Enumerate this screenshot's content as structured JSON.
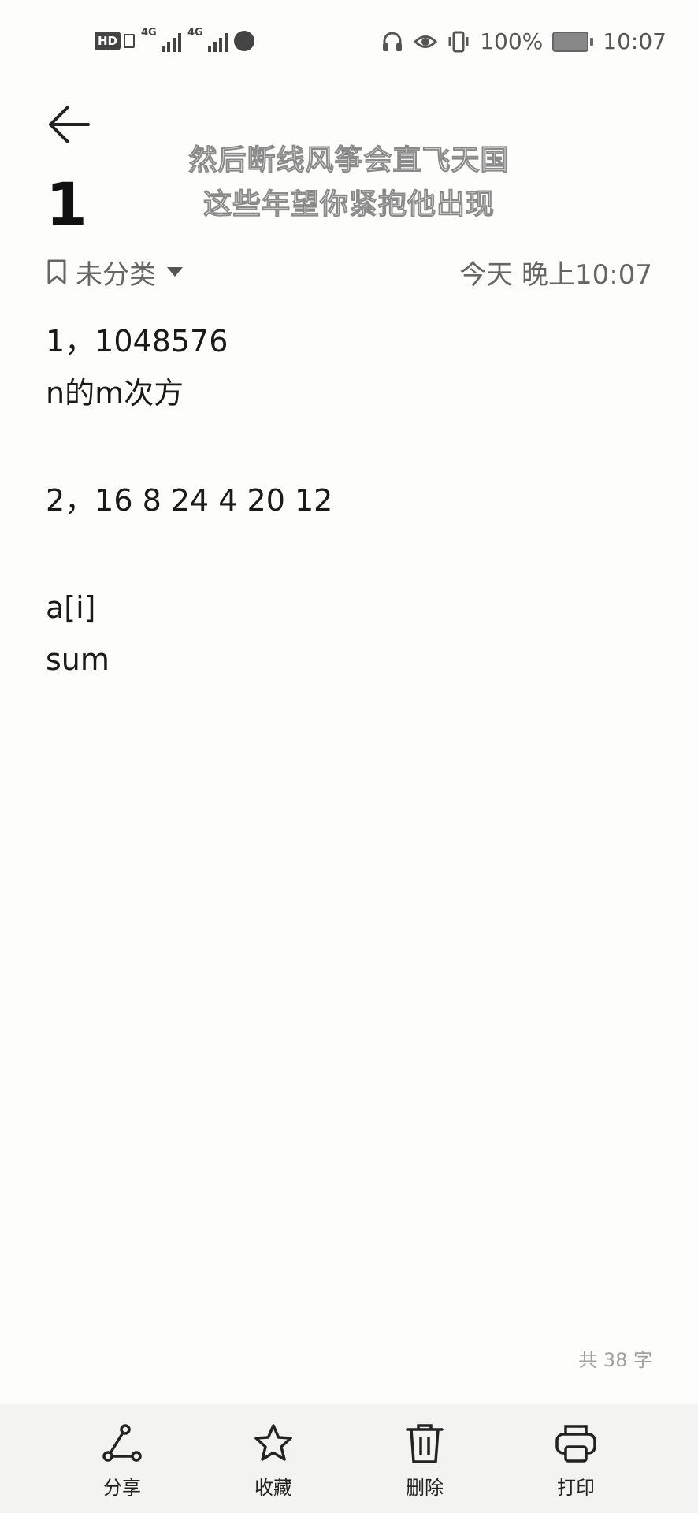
{
  "status_bar": {
    "left_badge": "HD",
    "signal_label_1": "4G",
    "signal_label_2": "4G",
    "battery_percent": "100%",
    "time": "10:07",
    "icons": [
      "headphones-icon",
      "eye-icon",
      "vibrate-icon",
      "battery-icon"
    ]
  },
  "lyrics": {
    "line1": "然后断线风筝会直飞天国",
    "line2": "这些年望你紧抱他出现"
  },
  "note": {
    "title": "1",
    "category": "未分类",
    "timestamp": "今天 晚上10:07",
    "lines": [
      "1，1048576",
      "n的m次方",
      "",
      "2，16 8 24 4 20 12",
      "",
      "a[i]",
      "sum"
    ],
    "word_count": "共 38 字"
  },
  "toolbar": {
    "share": "分享",
    "favorite": "收藏",
    "delete": "删除",
    "print": "打印"
  },
  "colors": {
    "background": "#fdfdfb",
    "toolbar_bg": "#f3f3f1",
    "text": "#1a1a1a",
    "muted": "#666666"
  }
}
